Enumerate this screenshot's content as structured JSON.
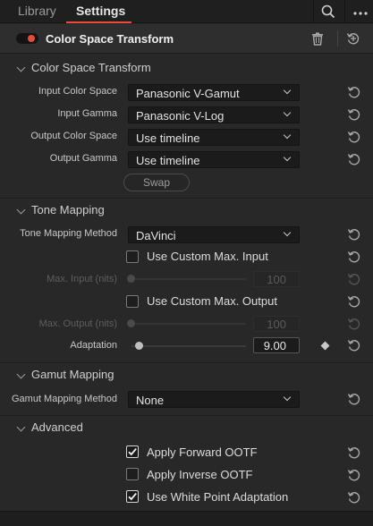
{
  "tabs": [
    {
      "label": "Library",
      "active": false
    },
    {
      "label": "Settings",
      "active": true
    }
  ],
  "accent_color": "#e64b3c",
  "topbar_icons": [
    "search-icon",
    "more-options-icon"
  ],
  "effect": {
    "title": "Color Space Transform",
    "enabled": true,
    "header_icons": [
      "trash-icon",
      "reset-all-icon"
    ]
  },
  "sections": {
    "cst": {
      "title": "Color Space Transform",
      "rows": [
        {
          "label": "Input Color Space",
          "value": "Panasonic V-Gamut"
        },
        {
          "label": "Input Gamma",
          "value": "Panasonic V-Log"
        },
        {
          "label": "Output Color Space",
          "value": "Use timeline"
        },
        {
          "label": "Output Gamma",
          "value": "Use timeline"
        }
      ],
      "swap_label": "Swap"
    },
    "tone": {
      "title": "Tone Mapping",
      "method_label": "Tone Mapping Method",
      "method_value": "DaVinci",
      "custom_input_label": "Use Custom Max. Input",
      "custom_input_checked": false,
      "max_input_label": "Max. Input (nits)",
      "max_input_value": "100",
      "custom_output_label": "Use Custom Max. Output",
      "custom_output_checked": false,
      "max_output_label": "Max. Output (nits)",
      "max_output_value": "100",
      "adaptation_label": "Adaptation",
      "adaptation_value": "9.00"
    },
    "gamut": {
      "title": "Gamut Mapping",
      "method_label": "Gamut Mapping Method",
      "method_value": "None"
    },
    "advanced": {
      "title": "Advanced",
      "options": [
        {
          "label": "Apply Forward OOTF",
          "checked": true
        },
        {
          "label": "Apply Inverse OOTF",
          "checked": false
        },
        {
          "label": "Use White Point Adaptation",
          "checked": true
        }
      ]
    }
  }
}
